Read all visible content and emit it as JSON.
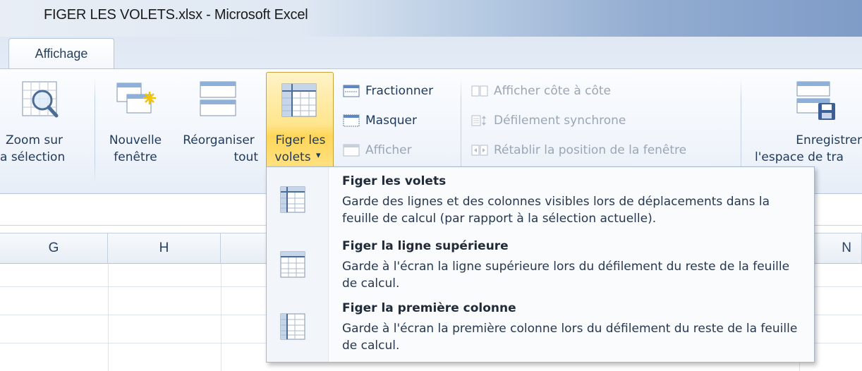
{
  "window": {
    "title": "FIGER LES VOLETS.xlsx - Microsoft Excel"
  },
  "tabs": [
    {
      "label": "Affichage"
    }
  ],
  "ribbon": {
    "zoom_line1": "Zoom sur",
    "zoom_line2": "a sélection",
    "new_window_line1": "Nouvelle",
    "new_window_line2": "fenêtre",
    "arrange_line1": "Réorganiser",
    "arrange_line2": "tout",
    "freeze_line1": "Figer les",
    "freeze_line2": "volets",
    "freeze_arrow": "▾",
    "split": "Fractionner",
    "hide": "Masquer",
    "unhide": "Afficher",
    "side_by_side": "Afficher côte à côte",
    "sync_scroll": "Défilement synchrone",
    "reset_position": "Rétablir la position de la fenêtre",
    "save_ws_line1": "Enregistrer",
    "save_ws_line2": "l'espace de tra"
  },
  "columns": [
    "G",
    "H",
    "N"
  ],
  "freeze_menu": {
    "items": [
      {
        "title": "Figer les volets",
        "desc": "Garde des lignes et des colonnes visibles lors de déplacements dans la feuille de calcul (par rapport à la sélection actuelle)."
      },
      {
        "title": "Figer la ligne supérieure",
        "desc": "Garde à l'écran la ligne supérieure lors du défilement du reste de la feuille de calcul."
      },
      {
        "title": "Figer la première colonne",
        "desc": "Garde à l'écran la première colonne lors du défilement du reste de la feuille de calcul."
      }
    ]
  },
  "colors": {
    "accent_highlight": "#ffd659",
    "ribbon_text": "#1e395b",
    "disabled_text": "#9aa6b5"
  }
}
